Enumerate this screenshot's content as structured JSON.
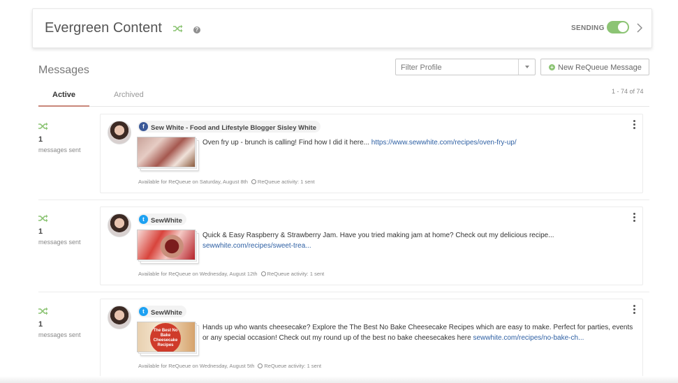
{
  "header": {
    "title": "Evergreen Content",
    "help_glyph": "?",
    "sending_label": "SENDING",
    "sending_on": true
  },
  "messages_section": {
    "title": "Messages",
    "filter": {
      "placeholder": "Filter Profile"
    },
    "new_button": {
      "icon_glyph": "+",
      "label": "New ReQueue Message"
    }
  },
  "tabs": [
    {
      "label": "Active",
      "active": true
    },
    {
      "label": "Archived",
      "active": false
    }
  ],
  "count_label": "1 - 74 of 74",
  "colors": {
    "accent_green": "#8cc474",
    "link_blue": "#2d5fa3",
    "tab_underline": "#c8867a"
  },
  "items": [
    {
      "sent_count": "1",
      "sent_label": "messages sent",
      "network": "facebook",
      "network_glyph": "f",
      "profile_name": "Sew White - Food and Lifestyle Blogger Sisley White",
      "text": "Oven fry up - brunch is calling! Find how I did it here... ",
      "link": "https://www.sewwhite.com/recipes/oven-fry-up/",
      "available": "Available for ReQueue on Saturday, August 8th",
      "activity": "ReQueue activity: 1 sent"
    },
    {
      "sent_count": "1",
      "sent_label": "messages sent",
      "network": "twitter",
      "network_glyph": "t",
      "profile_name": "SewWhite",
      "text": "Quick & Easy Raspberry & Strawberry Jam. Have you tried making jam at home? Check out my delicious recipe... ",
      "link": "sewwhite.com/recipes/sweet-trea...",
      "available": "Available for ReQueue on Wednesday, August 12th",
      "activity": "ReQueue activity: 1 sent"
    },
    {
      "sent_count": "1",
      "sent_label": "messages sent",
      "network": "twitter",
      "network_glyph": "t",
      "profile_name": "SewWhite",
      "thumb_text": "The Best No Bake Cheesecake Recipes",
      "text": "Hands up who wants cheesecake? Explore the The Best No Bake Cheesecake Recipes which are easy to make. Perfect for parties, events or any special occasion! Check out my round up of the best no bake cheesecakes here ",
      "link": "sewwhite.com/recipes/no-bake-ch...",
      "available": "Available for ReQueue on Wednesday, August 5th",
      "activity": "ReQueue activity: 1 sent"
    }
  ]
}
